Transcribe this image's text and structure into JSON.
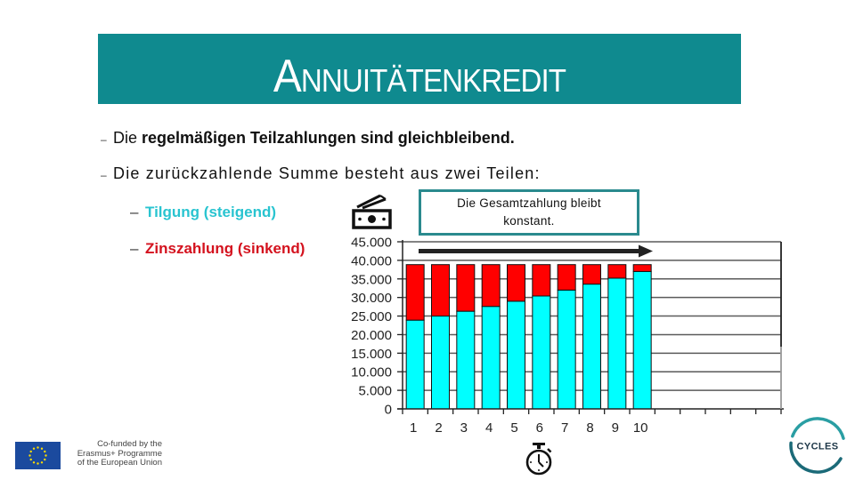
{
  "slide": {
    "title": "Annuitätenkredit",
    "bullets": [
      {
        "marker": "–",
        "parts": [
          {
            "text": "Die ",
            "bold": false
          },
          {
            "text": "regelmäßigen Teilzahlungen sind gleichbleibend.",
            "bold": true
          }
        ]
      },
      {
        "marker": "–",
        "text": "Die zurückzahlende Summe besteht aus zwei Teilen:"
      }
    ],
    "sub_bullets": [
      {
        "marker": "–",
        "text": "Tilgung (steigend)",
        "color": "#29c4d0"
      },
      {
        "marker": "–",
        "text": "Zinszahlung (sinkend)",
        "color": "#d4121e"
      }
    ],
    "callout": {
      "line1": "Die Gesamtzahlung bleibt",
      "line2": "konstant."
    },
    "icons": {
      "money": "money-bill-icon",
      "stopwatch": "stopwatch-icon"
    },
    "footer": {
      "eu_lines": [
        "Co-funded by the",
        "Erasmus+ Programme",
        "of the European Union"
      ],
      "logo_text": "CYCLES"
    },
    "colors": {
      "banner": "#0f8a8f",
      "callout_border": "#2a8a8e",
      "tilgung_text": "#29c4d0",
      "zins_text": "#d4121e"
    }
  },
  "chart_data": {
    "type": "bar",
    "stacked": true,
    "title": "",
    "xlabel": "",
    "ylabel": "",
    "categories": [
      "1",
      "2",
      "3",
      "4",
      "5",
      "6",
      "7",
      "8",
      "9",
      "10"
    ],
    "series": [
      {
        "key": "tilgung",
        "name": "Tilgung",
        "color": "#00ffff",
        "values": [
          23900,
          25000,
          26300,
          27600,
          29000,
          30400,
          32000,
          33600,
          35200,
          37000
        ]
      },
      {
        "key": "zins",
        "name": "Zinszahlung",
        "color": "#ff0000",
        "values": [
          14950,
          13850,
          12550,
          11250,
          9850,
          8450,
          6850,
          5250,
          3650,
          1850
        ]
      }
    ],
    "total_per_period": 38850,
    "ylim": [
      0,
      45000
    ],
    "xlim": [
      0,
      15
    ],
    "y_ticks": [
      {
        "value": 0,
        "label": "0"
      },
      {
        "value": 5000,
        "label": "5.000"
      },
      {
        "value": 10000,
        "label": "10.000"
      },
      {
        "value": 15000,
        "label": "15.000"
      },
      {
        "value": 20000,
        "label": "20.000"
      },
      {
        "value": 25000,
        "label": "25.000"
      },
      {
        "value": 30000,
        "label": "30.000"
      },
      {
        "value": 35000,
        "label": "35.000"
      },
      {
        "value": 40000,
        "label": "40.000"
      },
      {
        "value": 45000,
        "label": "45.000"
      }
    ],
    "grid": true,
    "legend": "none",
    "annotation": "Die Gesamtzahlung bleibt konstant."
  }
}
